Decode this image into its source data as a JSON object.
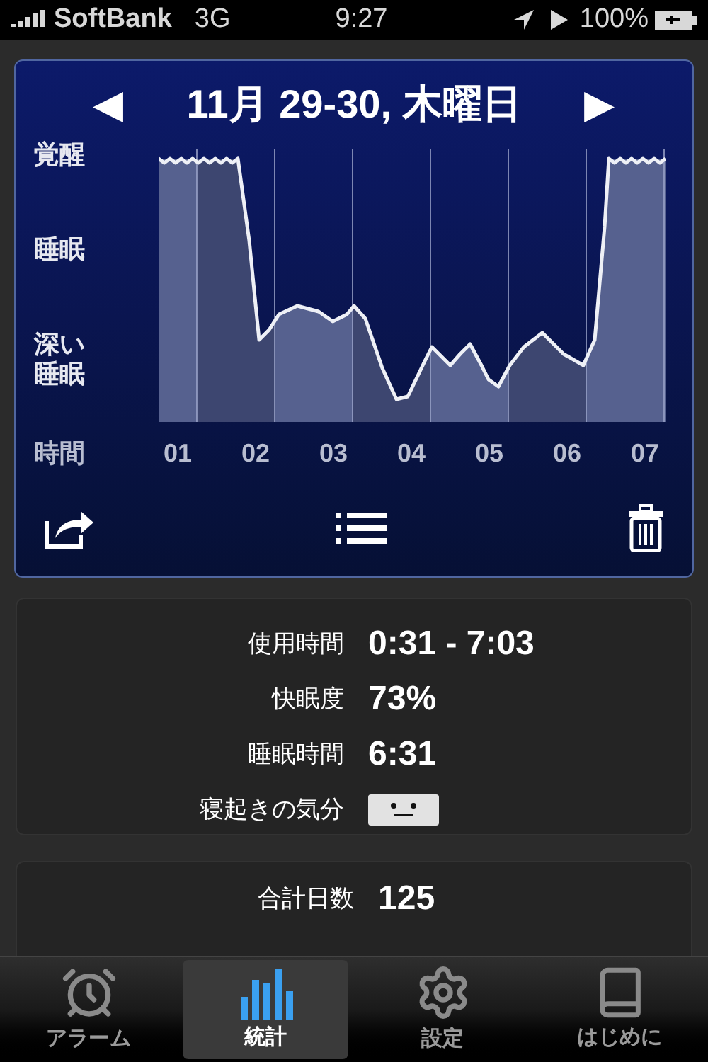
{
  "status_bar": {
    "carrier": "SoftBank",
    "network": "3G",
    "time": "9:27",
    "battery": "100%"
  },
  "chart_panel": {
    "prev": "◀",
    "title": "11月 29-30, 木曜日",
    "next": "▶",
    "y_labels": [
      "覚醒",
      "睡眠",
      "深い睡眠"
    ],
    "x_axis_title": "時間",
    "x_labels": [
      "01",
      "02",
      "03",
      "04",
      "05",
      "06",
      "07"
    ]
  },
  "stats": [
    {
      "label": "使用時間",
      "value": "0:31 - 7:03",
      "kind": "text"
    },
    {
      "label": "快眠度",
      "value": "73%",
      "kind": "text"
    },
    {
      "label": "睡眠時間",
      "value": "6:31",
      "kind": "text"
    },
    {
      "label": "寝起きの気分",
      "kind": "mood"
    }
  ],
  "totals": [
    {
      "label": "合計日数",
      "value": "125"
    }
  ],
  "tab_bar": [
    {
      "label": "アラーム",
      "selected": false,
      "kind": "alarm"
    },
    {
      "label": "統計",
      "selected": true,
      "kind": "stats"
    },
    {
      "label": "設定",
      "selected": false,
      "kind": "settings"
    },
    {
      "label": "はじめに",
      "selected": false,
      "kind": "intro"
    }
  ]
}
